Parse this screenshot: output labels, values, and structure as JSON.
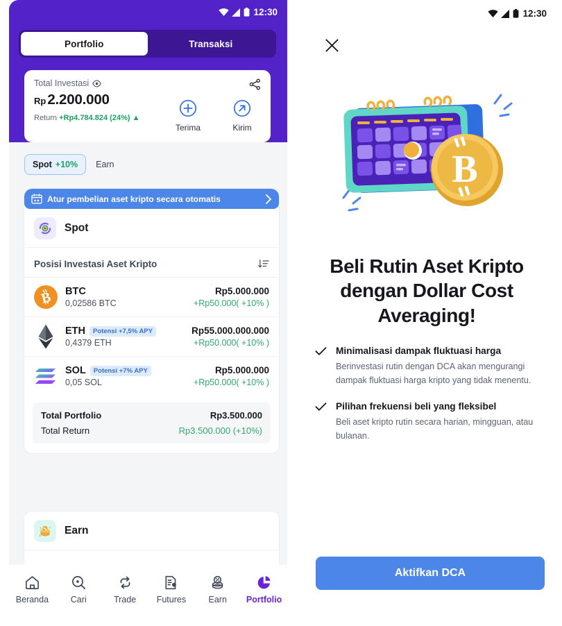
{
  "left_phone": {
    "status_bar": {
      "time": "12:30",
      "icons": [
        "wifi-icon",
        "signal-icon",
        "battery-icon"
      ]
    },
    "tabs": [
      {
        "label": "Portfolio",
        "active": true
      },
      {
        "label": "Transaksi",
        "active": false
      }
    ],
    "balance_card": {
      "label": "Total Investasi",
      "eye_icon": "eye-icon",
      "share_icon": "share-icon",
      "currency": "Rp",
      "amount": "2.200.000",
      "return_label": "Return",
      "return_value": "+Rp4.784.824 (24%) ▲",
      "actions": [
        {
          "label": "Terima",
          "icon": "plus-circle-icon"
        },
        {
          "label": "Kirim",
          "icon": "arrow-up-right-circle-icon"
        }
      ]
    },
    "filter_chips": [
      {
        "name": "Spot",
        "pct": "+10%",
        "active": true
      },
      {
        "name": "Earn",
        "pct": "",
        "active": false
      }
    ],
    "dca_banner": {
      "text": "Atur pembelian aset kripto secara otomatis",
      "icon": "calendar-repeat-icon",
      "chevron": "chevron-right-icon"
    },
    "spot_section": {
      "title": "Spot",
      "icon": "spot-refresh-icon"
    },
    "positions": {
      "header": "Posisi Investasi Aset Kripto",
      "sort_icon": "sort-icon",
      "assets": [
        {
          "symbol": "BTC",
          "badge": "",
          "quantity": "0,02586 BTC",
          "value": "Rp5.000.000",
          "change": "+Rp50.000( +10% )",
          "logo": "bitcoin-logo"
        },
        {
          "symbol": "ETH",
          "badge": "Potensi +7,5% APY",
          "quantity": "0,4379 ETH",
          "value": "Rp55.000.000.000",
          "change": "+Rp50.000( +10% )",
          "logo": "ethereum-logo"
        },
        {
          "symbol": "SOL",
          "badge": "Potensi +7% APY",
          "quantity": "0,05 SOL",
          "value": "Rp5.000.000",
          "change": "+Rp50.000( +10% )",
          "logo": "solana-logo"
        }
      ],
      "totals": [
        {
          "key": "Total Portfolio",
          "value": "Rp3.500.000",
          "bold": true,
          "green": false
        },
        {
          "key": "Total Return",
          "value": "Rp3.500.000 (+10%)",
          "bold": false,
          "green": true
        }
      ]
    },
    "earn_section": {
      "title": "Earn",
      "icon": "earn-coins-icon"
    },
    "bottom_nav": [
      {
        "label": "Beranda",
        "icon": "home-icon",
        "active": false
      },
      {
        "label": "Cari",
        "icon": "search-icon",
        "active": false
      },
      {
        "label": "Trade",
        "icon": "swap-icon",
        "active": false
      },
      {
        "label": "Futures",
        "icon": "document-icon",
        "active": false
      },
      {
        "label": "Earn",
        "icon": "coins-icon",
        "active": false
      },
      {
        "label": "Portfolio",
        "icon": "pie-chart-icon",
        "active": true
      }
    ]
  },
  "right_panel": {
    "status_bar": {
      "time": "12:30"
    },
    "close_icon": "close-icon",
    "hero_icon": "calendar-bitcoin-illustration",
    "title": "Beli Rutin Aset Kripto dengan Dollar Cost Averaging!",
    "features": [
      {
        "check_icon": "check-icon",
        "title": "Minimalisasi dampak fluktuasi harga",
        "desc": "Berinvestasi rutin dengan DCA akan mengurangi dampak fluktuasi harga kripto yang tidak menentu."
      },
      {
        "check_icon": "check-icon",
        "title": "Pilihan frekuensi beli yang fleksibel",
        "desc": "Beli aset kripto rutin secara harian, mingguan, atau bulanan."
      }
    ],
    "cta_label": "Aktifkan DCA"
  },
  "colors": {
    "purple_header": "#5422c9",
    "tabbar_bg": "#3d1694",
    "blue_accent": "#4c86e8",
    "green": "#2faa6d",
    "portfolio_active": "#6b23d6",
    "badge_bg": "#dcebfb",
    "badge_text": "#3a6fc4"
  }
}
